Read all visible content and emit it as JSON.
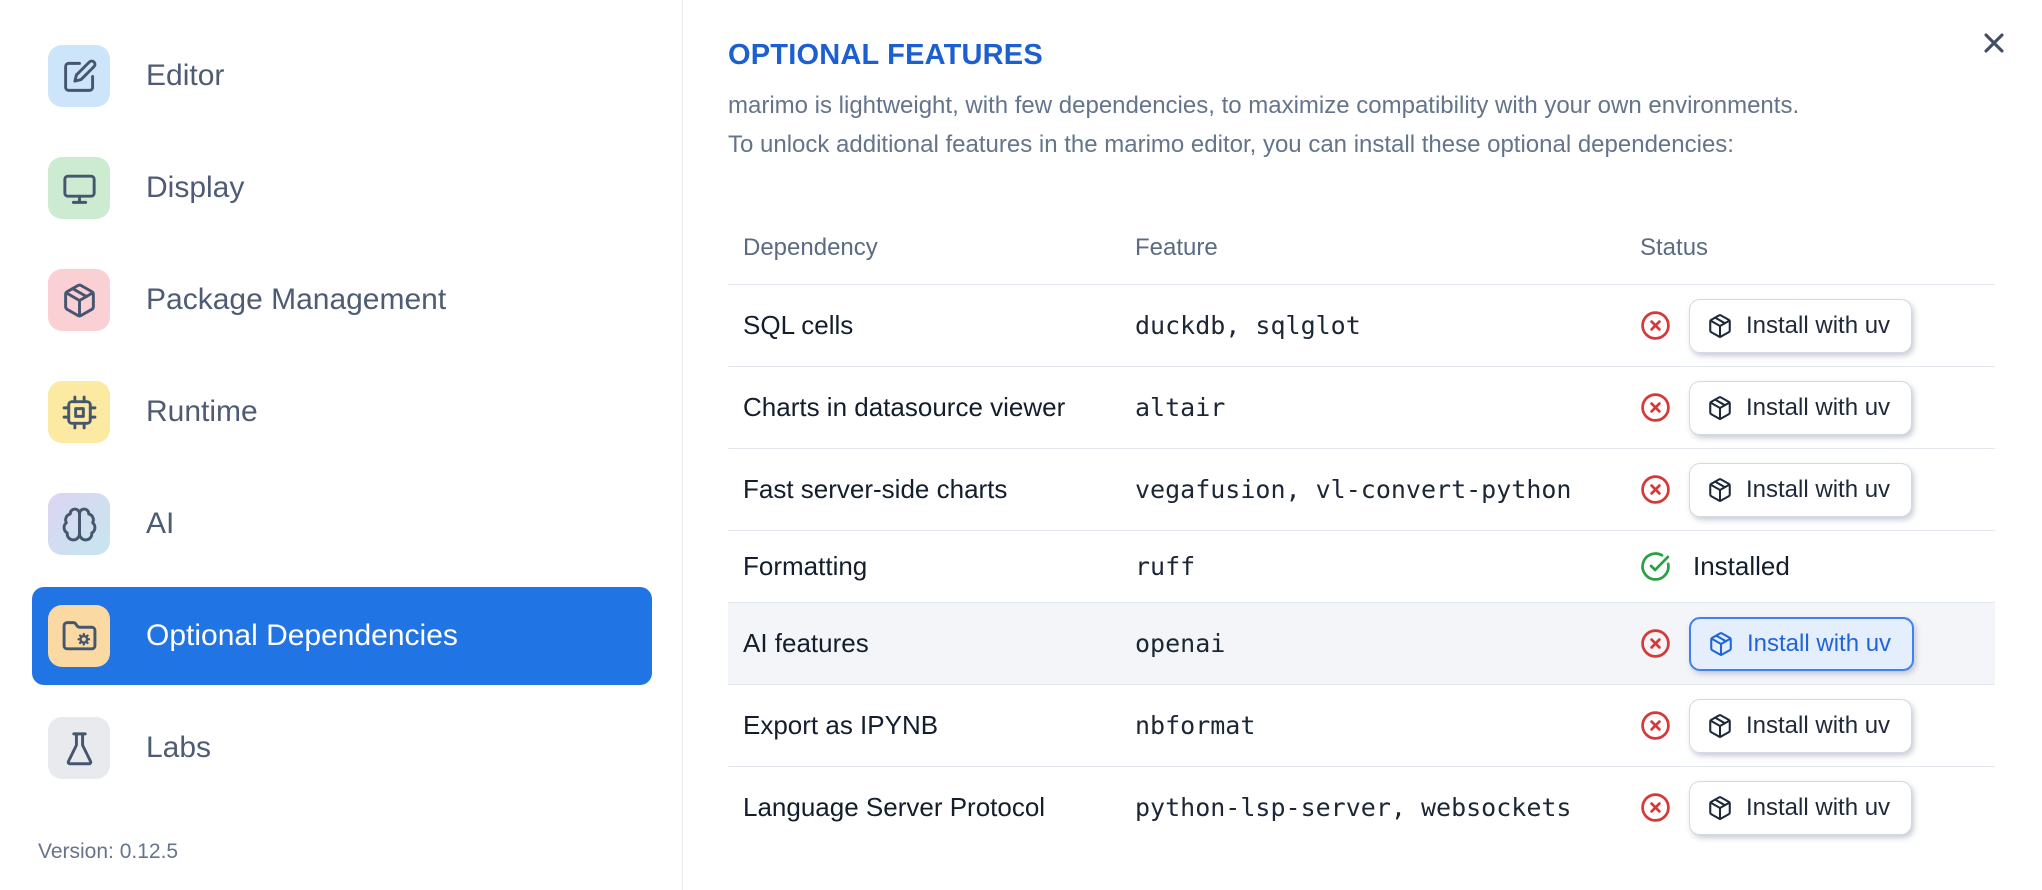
{
  "colors": {
    "accent_selected": "#2174e4",
    "title_blue": "#1b5fd1",
    "status_danger": "#d43a3a",
    "status_success": "#27a144",
    "accent_button_border": "#3f82ee",
    "accent_button_bg": "#e4eefc",
    "accent_button_text": "#2064da"
  },
  "sidebar": {
    "items": [
      {
        "id": "editor",
        "label": "Editor",
        "icon": "edit-icon",
        "tile_bg": "#cde5fa"
      },
      {
        "id": "display",
        "label": "Display",
        "icon": "monitor-icon",
        "tile_bg": "#cdebd0"
      },
      {
        "id": "package-management",
        "label": "Package Management",
        "icon": "package-icon",
        "tile_bg": "#fbd0d5"
      },
      {
        "id": "runtime",
        "label": "Runtime",
        "icon": "cpu-icon",
        "tile_bg": "#fce9a2"
      },
      {
        "id": "ai",
        "label": "AI",
        "icon": "brain-icon",
        "tile_bg": "linear-gradient(135deg,#ddd4f3,#c5e7ed)"
      },
      {
        "id": "optional-dependencies",
        "label": "Optional Dependencies",
        "icon": "folder-cog-icon",
        "tile_bg": "#fbd9a2",
        "selected": true
      },
      {
        "id": "labs",
        "label": "Labs",
        "icon": "flask-icon",
        "tile_bg": "#e8eaee"
      }
    ],
    "version_label": "Version: 0.12.5"
  },
  "main": {
    "title": "OPTIONAL FEATURES",
    "description_lines": [
      "marimo is lightweight, with few dependencies, to maximize compatibility with your own environments.",
      "To unlock additional features in the marimo editor, you can install these optional dependencies:"
    ],
    "table": {
      "headers": [
        "Dependency",
        "Feature",
        "Status"
      ],
      "rows": [
        {
          "dependency": "SQL cells",
          "feature": "duckdb, sqlglot",
          "status": "missing",
          "action_label": "Install with uv"
        },
        {
          "dependency": "Charts in datasource viewer",
          "feature": "altair",
          "status": "missing",
          "action_label": "Install with uv"
        },
        {
          "dependency": "Fast server-side charts",
          "feature": "vegafusion, vl-convert-python",
          "status": "missing",
          "action_label": "Install with uv"
        },
        {
          "dependency": "Formatting",
          "feature": "ruff",
          "status": "installed",
          "status_label": "Installed"
        },
        {
          "dependency": "AI features",
          "feature": "openai",
          "status": "missing",
          "action_label": "Install with uv",
          "highlighted": true
        },
        {
          "dependency": "Export as IPYNB",
          "feature": "nbformat",
          "status": "missing",
          "action_label": "Install with uv"
        },
        {
          "dependency": "Language Server Protocol",
          "feature": "python-lsp-server, websockets",
          "status": "missing",
          "action_label": "Install with uv"
        }
      ]
    }
  }
}
